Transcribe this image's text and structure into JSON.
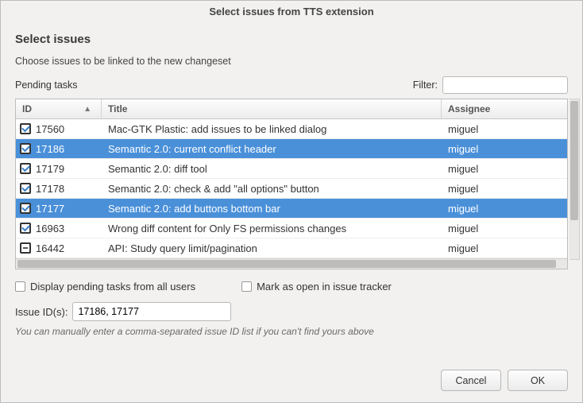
{
  "window": {
    "title": "Select issues from TTS extension"
  },
  "header": {
    "section": "Select issues",
    "subtext": "Choose issues to be linked to the new changeset"
  },
  "top": {
    "pending_label": "Pending tasks",
    "filter_label": "Filter:",
    "filter_value": ""
  },
  "table": {
    "columns": {
      "id": "ID",
      "title": "Title",
      "assignee": "Assignee"
    },
    "sort_indicator": "▲",
    "rows": [
      {
        "checked": true,
        "selected": false,
        "id": "17560",
        "title": "Mac-GTK Plastic: add issues to be linked dialog",
        "assignee": "miguel"
      },
      {
        "checked": true,
        "selected": true,
        "id": "17186",
        "title": "Semantic 2.0: current conflict header",
        "assignee": "miguel"
      },
      {
        "checked": true,
        "selected": false,
        "id": "17179",
        "title": "Semantic 2.0: diff tool",
        "assignee": "miguel"
      },
      {
        "checked": true,
        "selected": false,
        "id": "17178",
        "title": "Semantic 2.0: check & add \"all options\" button",
        "assignee": "miguel"
      },
      {
        "checked": true,
        "selected": true,
        "id": "17177",
        "title": "Semantic 2.0: add buttons bottom bar",
        "assignee": "miguel"
      },
      {
        "checked": true,
        "selected": false,
        "id": "16963",
        "title": "Wrong diff content for Only FS permissions changes",
        "assignee": "miguel"
      },
      {
        "checked": "mid",
        "selected": false,
        "id": "16442",
        "title": "API: Study query limit/pagination",
        "assignee": "miguel"
      }
    ]
  },
  "options": {
    "all_users_label": "Display pending tasks from all users",
    "mark_open_label": "Mark as open in issue tracker"
  },
  "ids": {
    "label": "Issue ID(s):",
    "value": "17186, 17177",
    "hint": "You can manually enter a comma-separated issue ID list if you can't find yours above"
  },
  "buttons": {
    "cancel": "Cancel",
    "ok": "OK"
  }
}
